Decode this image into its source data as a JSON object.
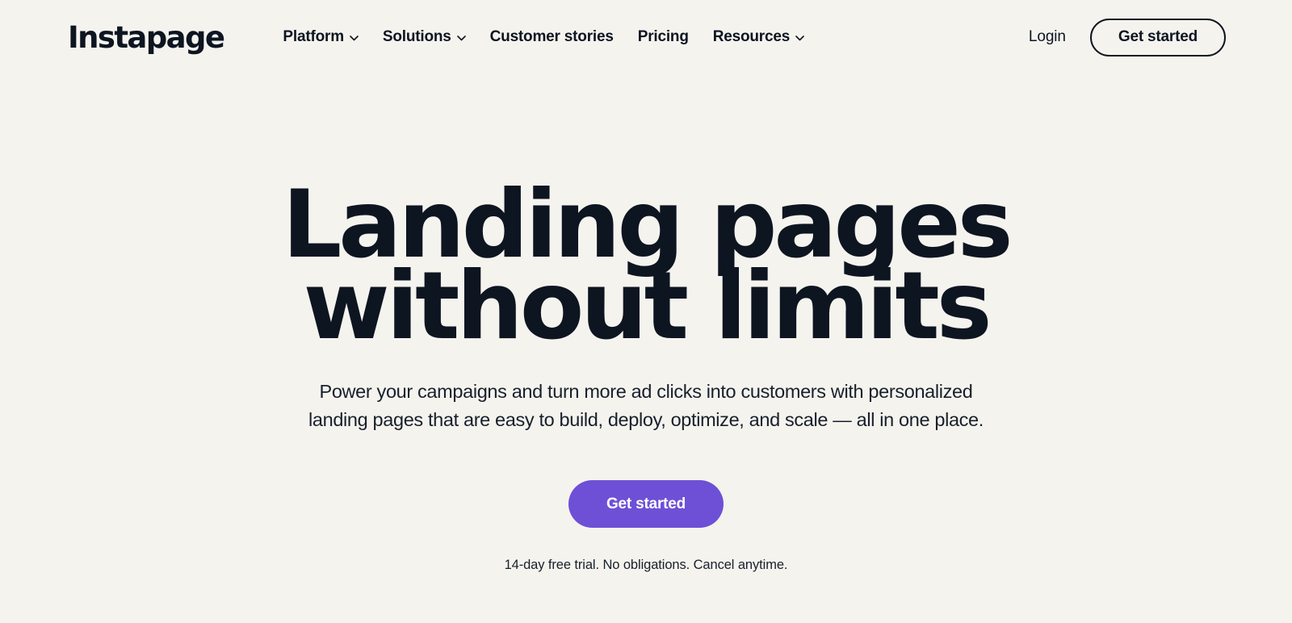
{
  "theme": {
    "background": "#F5F3EE",
    "text": "#0D1521",
    "accent": "#6D50D6",
    "button_text": "#FFFFFF"
  },
  "header": {
    "logo_text": "Instapage",
    "nav_items": [
      {
        "label": "Platform",
        "icon": "chevron-down-icon",
        "has_dropdown": true
      },
      {
        "label": "Solutions",
        "icon": "chevron-down-icon",
        "has_dropdown": true
      },
      {
        "label": "Customer stories",
        "icon": "",
        "has_dropdown": false
      },
      {
        "label": "Pricing",
        "icon": "",
        "has_dropdown": false
      },
      {
        "label": "Resources",
        "icon": "chevron-down-icon",
        "has_dropdown": true
      }
    ],
    "login_label": "Login",
    "get_started_label": "Get started"
  },
  "hero": {
    "headline_line1": "Landing pages",
    "headline_line2": "without limits",
    "subhead_line1": "Power your campaigns and turn more ad clicks into customers with personalized",
    "subhead_line2": "landing pages that are easy to build, deploy, optimize, and scale — all in one place.",
    "cta_label": "Get started",
    "fineprint": "14-day free trial. No obligations. Cancel anytime."
  }
}
